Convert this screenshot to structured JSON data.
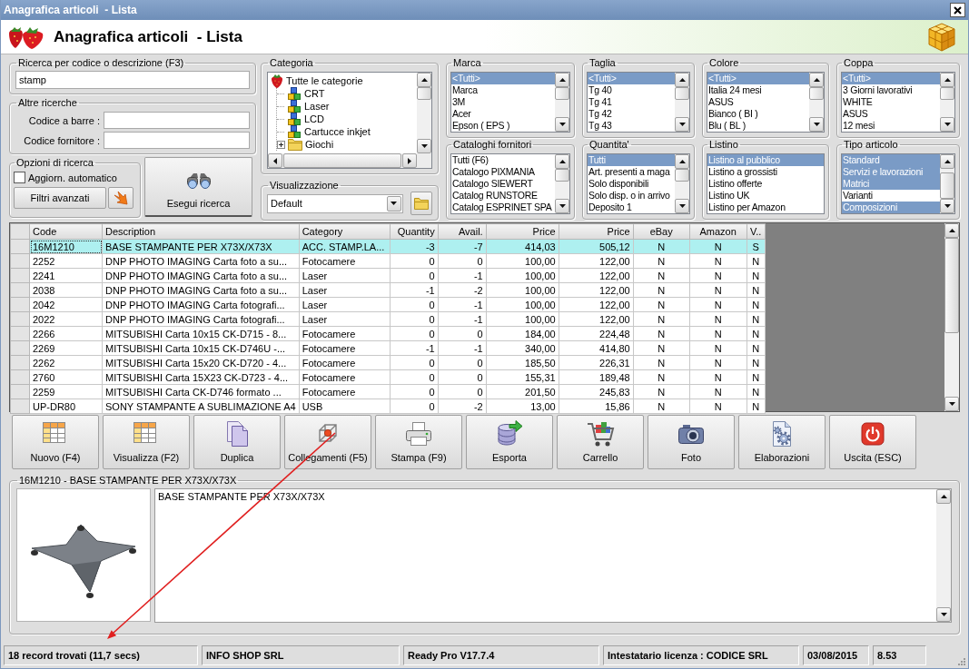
{
  "window": {
    "title": "Anagrafica articoli  - Lista"
  },
  "header": {
    "title": "Anagrafica articoli  - Lista"
  },
  "search": {
    "label": "Ricerca per codice o descrizione (F3)",
    "value": "stamp"
  },
  "other_searches": {
    "label": "Altre ricerche",
    "fields": [
      {
        "label": "Codice a barre :"
      },
      {
        "label": "Codice fornitore :"
      }
    ]
  },
  "search_options": {
    "label": "Opzioni di ricerca",
    "auto_update": {
      "label": "Aggiorn. automatico",
      "checked": false
    },
    "advanced_filters_button": "Filtri avanzati"
  },
  "run_search_button": "Esegui ricerca",
  "category": {
    "label": "Categoria",
    "tree": [
      {
        "label": "Tutte le categorie",
        "kind": "root",
        "children": [
          {
            "label": "CRT",
            "kind": "category"
          },
          {
            "label": "Laser",
            "kind": "category"
          },
          {
            "label": "LCD",
            "kind": "category"
          },
          {
            "label": "Cartucce inkjet",
            "kind": "category"
          },
          {
            "label": "Giochi",
            "kind": "folder",
            "expanded": false
          }
        ]
      }
    ]
  },
  "display": {
    "label": "Visualizzazione",
    "value": "Default"
  },
  "filters": [
    {
      "label": "Marca",
      "items": [
        {
          "label": "<Tutti>",
          "selected": true
        },
        {
          "label": "Marca",
          "selected": false
        },
        {
          "label": "3M",
          "selected": false
        },
        {
          "label": "Acer",
          "selected": false
        },
        {
          "label": "Epson ( EPS )",
          "selected": false
        }
      ]
    },
    {
      "label": "Taglia",
      "items": [
        {
          "label": "<Tutti>",
          "selected": true
        },
        {
          "label": "Tg 40",
          "selected": false
        },
        {
          "label": "Tg 41",
          "selected": false
        },
        {
          "label": "Tg 42",
          "selected": false
        },
        {
          "label": "Tg 43",
          "selected": false
        }
      ]
    },
    {
      "label": "Colore",
      "items": [
        {
          "label": "<Tutti>",
          "selected": true
        },
        {
          "label": "Italia 24 mesi",
          "selected": false
        },
        {
          "label": "ASUS",
          "selected": false
        },
        {
          "label": "Bianco ( BI )",
          "selected": false
        },
        {
          "label": "Blu ( BL )",
          "selected": false
        }
      ]
    },
    {
      "label": "Coppa",
      "items": [
        {
          "label": "<Tutti>",
          "selected": true
        },
        {
          "label": "3 Giorni lavorativi",
          "selected": false
        },
        {
          "label": "WHITE",
          "selected": false
        },
        {
          "label": "ASUS",
          "selected": false
        },
        {
          "label": "12 mesi",
          "selected": false
        }
      ]
    },
    {
      "label": "Cataloghi fornitori",
      "items": [
        {
          "label": "Tutti (F6)",
          "selected": false
        },
        {
          "label": "Catalogo PIXMANIA",
          "selected": false
        },
        {
          "label": "Catalogo SIEWERT",
          "selected": false
        },
        {
          "label": "Catalog RUNSTORE",
          "selected": false
        },
        {
          "label": "Catalog ESPRINET SPA",
          "selected": false
        }
      ]
    },
    {
      "label": "Quantita'",
      "items": [
        {
          "label": "Tutti",
          "selected": true
        },
        {
          "label": "Art. presenti a maga",
          "selected": false
        },
        {
          "label": "Solo disponibili",
          "selected": false
        },
        {
          "label": "Solo disp. o in arrivo",
          "selected": false
        },
        {
          "label": "Deposito 1",
          "selected": false
        }
      ]
    },
    {
      "label": "Listino",
      "items": [
        {
          "label": "Listino al pubblico",
          "selected": true
        },
        {
          "label": "Listino a grossisti",
          "selected": false
        },
        {
          "label": "Listino offerte",
          "selected": false
        },
        {
          "label": "Listino UK",
          "selected": false
        },
        {
          "label": "Listino per Amazon",
          "selected": false
        }
      ]
    },
    {
      "label": "Tipo articolo",
      "items": [
        {
          "label": "Standard",
          "selected": true
        },
        {
          "label": "Servizi e lavorazioni",
          "selected": true
        },
        {
          "label": "Matrici",
          "selected": true
        },
        {
          "label": "Varianti",
          "selected": false
        },
        {
          "label": "Composizioni",
          "selected": true
        }
      ]
    }
  ],
  "table": {
    "columns": [
      "Code",
      "Description",
      "Category",
      "Quantity",
      "Avail.",
      "Price",
      "Price",
      "eBay",
      "Amazon",
      "V.."
    ],
    "rows": [
      {
        "cells": [
          "16M1210",
          "BASE STAMPANTE PER X73X/X73X",
          "ACC. STAMP.LA...",
          "-3",
          "-7",
          "414,03",
          "505,12",
          "N",
          "N",
          "S"
        ],
        "selected": true
      },
      {
        "cells": [
          "2252",
          "DNP PHOTO IMAGING Carta foto a su...",
          "Fotocamere",
          "0",
          "0",
          "100,00",
          "122,00",
          "N",
          "N",
          "N"
        ],
        "selected": false
      },
      {
        "cells": [
          "2241",
          "DNP PHOTO IMAGING Carta foto a su...",
          "Laser",
          "0",
          "-1",
          "100,00",
          "122,00",
          "N",
          "N",
          "N"
        ],
        "selected": false
      },
      {
        "cells": [
          "2038",
          "DNP PHOTO IMAGING Carta foto a su...",
          "Laser",
          "-1",
          "-2",
          "100,00",
          "122,00",
          "N",
          "N",
          "N"
        ],
        "selected": false
      },
      {
        "cells": [
          "2042",
          "DNP PHOTO IMAGING Carta fotografi...",
          "Laser",
          "0",
          "-1",
          "100,00",
          "122,00",
          "N",
          "N",
          "N"
        ],
        "selected": false
      },
      {
        "cells": [
          "2022",
          "DNP PHOTO IMAGING Carta fotografi...",
          "Laser",
          "0",
          "-1",
          "100,00",
          "122,00",
          "N",
          "N",
          "N"
        ],
        "selected": false
      },
      {
        "cells": [
          "2266",
          "MITSUBISHI Carta 10x15 CK-D715 - 8...",
          "Fotocamere",
          "0",
          "0",
          "184,00",
          "224,48",
          "N",
          "N",
          "N"
        ],
        "selected": false
      },
      {
        "cells": [
          "2269",
          "MITSUBISHI Carta 10x15 CK-D746U -...",
          "Fotocamere",
          "-1",
          "-1",
          "340,00",
          "414,80",
          "N",
          "N",
          "N"
        ],
        "selected": false
      },
      {
        "cells": [
          "2262",
          "MITSUBISHI Carta 15x20 CK-D720 - 4...",
          "Fotocamere",
          "0",
          "0",
          "185,50",
          "226,31",
          "N",
          "N",
          "N"
        ],
        "selected": false
      },
      {
        "cells": [
          "2760",
          "MITSUBISHI Carta 15X23 CK-D723 - 4...",
          "Fotocamere",
          "0",
          "0",
          "155,31",
          "189,48",
          "N",
          "N",
          "N"
        ],
        "selected": false
      },
      {
        "cells": [
          "2259",
          "MITSUBISHI Carta CK-D746 formato ...",
          "Fotocamere",
          "0",
          "0",
          "201,50",
          "245,83",
          "N",
          "N",
          "N"
        ],
        "selected": false
      },
      {
        "cells": [
          "UP-DR80",
          "SONY STAMPANTE A SUBLIMAZIONE A4",
          "USB",
          "0",
          "-2",
          "13,00",
          "15,86",
          "N",
          "N",
          "N"
        ],
        "selected": false
      }
    ]
  },
  "toolbar": [
    "Nuovo (F4)",
    "Visualizza (F2)",
    "Duplica",
    "Collegamenti (F5)",
    "Stampa (F9)",
    "Esporta",
    "Carrello",
    "Foto",
    "Elaborazioni",
    "Uscita (ESC)"
  ],
  "detail": {
    "title": "16M1210 - BASE STAMPANTE PER X73X/X73X",
    "notes": "BASE STAMPANTE PER X73X/X73X"
  },
  "status_bar": [
    "18 record trovati (11,7 secs)",
    "INFO SHOP SRL",
    "Ready Pro V17.7.4",
    "Intestatario licenza : CODICE SRL",
    "03/08/2015",
    "8.53"
  ]
}
